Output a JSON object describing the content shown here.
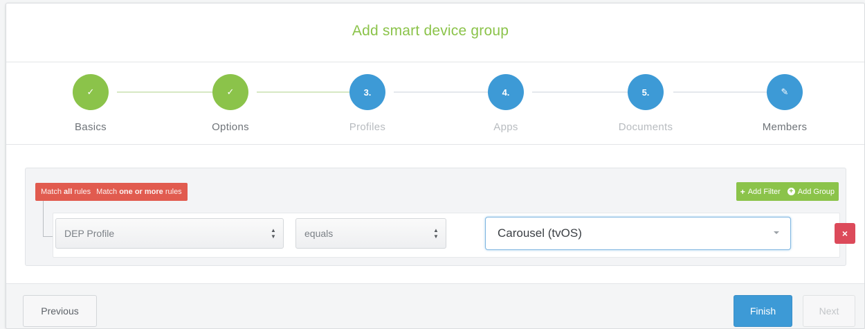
{
  "dialog": {
    "title": "Add smart device group"
  },
  "steps": [
    {
      "label": "Basics",
      "badge": "✓",
      "state": "done"
    },
    {
      "label": "Options",
      "badge": "✓",
      "state": "done"
    },
    {
      "label": "Profiles",
      "badge": "3.",
      "state": "todo"
    },
    {
      "label": "Apps",
      "badge": "4.",
      "state": "todo"
    },
    {
      "label": "Documents",
      "badge": "5.",
      "state": "todo"
    },
    {
      "label": "Members",
      "badge": "✎",
      "state": "current"
    }
  ],
  "rules": {
    "match_all_prefix": "Match",
    "match_all_bold": "all",
    "match_all_suffix": "rules",
    "match_some_prefix": "Match",
    "match_some_bold": "one or more",
    "match_some_suffix": "rules",
    "add_filter_label": "Add Filter",
    "add_group_label": "Add Group",
    "field_value": "DEP Profile",
    "operator_value": "equals",
    "criteria_value": "Carousel (tvOS)",
    "remove_icon": "×"
  },
  "footer": {
    "previous_label": "Previous",
    "finish_label": "Finish",
    "next_label": "Next"
  },
  "colors": {
    "accent_green": "#8bc34a",
    "accent_blue": "#3d9ad6",
    "danger_red": "#dc4a5a",
    "match_red": "#e15b4f"
  }
}
